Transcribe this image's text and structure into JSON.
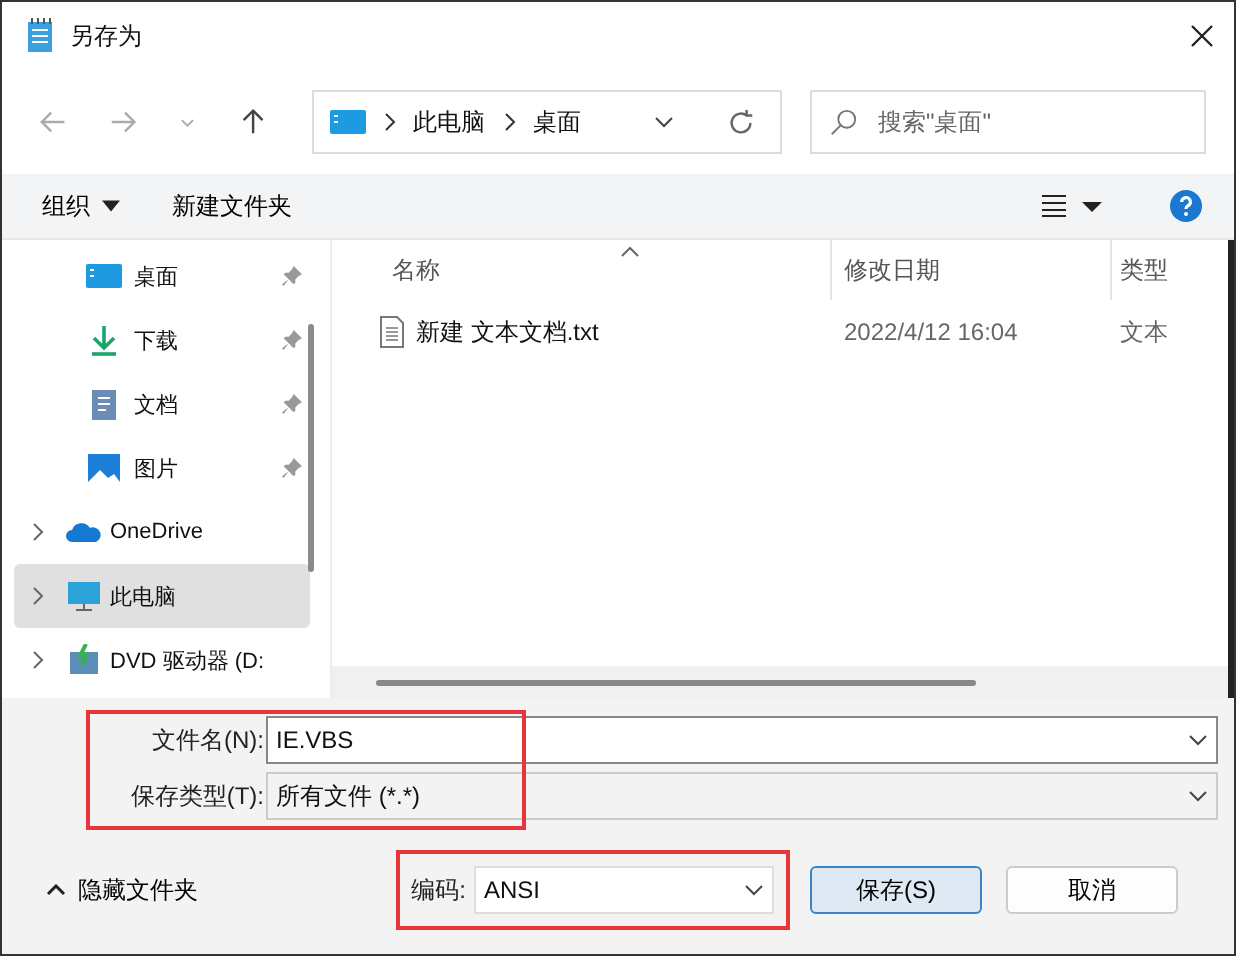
{
  "window": {
    "title": "另存为"
  },
  "nav": {
    "path": [
      "此电脑",
      "桌面"
    ],
    "search": {
      "placeholder": "搜索\"桌面\""
    }
  },
  "toolbar": {
    "organize": "组织",
    "new_folder": "新建文件夹"
  },
  "sidebar": {
    "items": [
      {
        "label": "桌面",
        "kind": "pinned",
        "selected": false
      },
      {
        "label": "下载",
        "kind": "pinned",
        "selected": false
      },
      {
        "label": "文档",
        "kind": "pinned",
        "selected": false
      },
      {
        "label": "图片",
        "kind": "pinned",
        "selected": false
      },
      {
        "label": "OneDrive",
        "kind": "expandable",
        "selected": false
      },
      {
        "label": "此电脑",
        "kind": "expandable",
        "selected": true
      },
      {
        "label": "DVD 驱动器 (D:",
        "kind": "expandable",
        "selected": false
      }
    ]
  },
  "table": {
    "columns": [
      "名称",
      "修改日期",
      "类型"
    ],
    "rows": [
      {
        "name": "新建 文本文档.txt",
        "modified": "2022/4/12 16:04",
        "type": "文本"
      }
    ]
  },
  "form": {
    "filename_label": "文件名(N):",
    "filename": "IE.VBS",
    "filetype_label": "保存类型(T):",
    "filetype": "所有文件  (*.*)",
    "encoding_label": "编码:",
    "encoding": "ANSI"
  },
  "footer": {
    "hide_folders": "隐藏文件夹",
    "save": "保存(S)",
    "cancel": "取消"
  }
}
